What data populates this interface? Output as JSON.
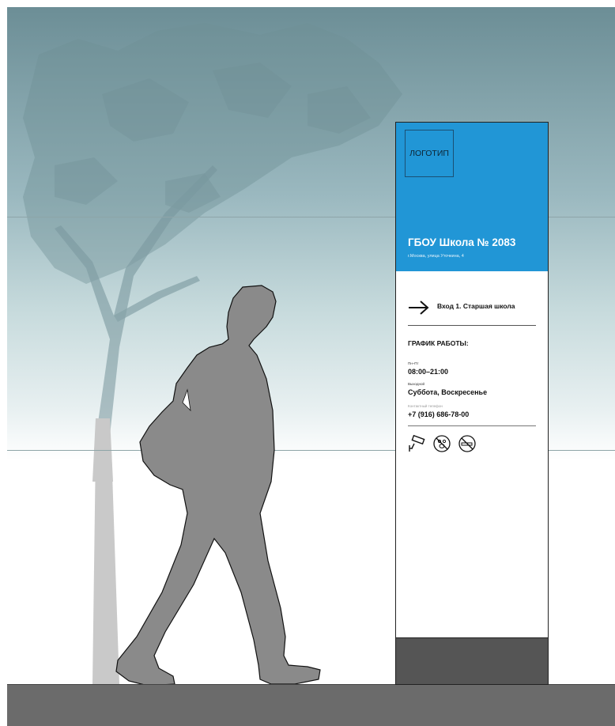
{
  "logo": {
    "label": "ЛОГОТИП"
  },
  "school": {
    "name": "ГБОУ Школа № 2083",
    "address": "г.Москва, улица Уточкина, 4"
  },
  "entry": {
    "label": "Вход 1. Старшая школа"
  },
  "schedule": {
    "title": "ГРАФИК РАБОТЫ:",
    "weekdays_label": "Пн–Пт",
    "weekdays_hours": "08:00–21:00",
    "weekend_label": "Выходной",
    "weekend_days": "Суббота, Воскресенье",
    "phone_label": "Контактный телефон",
    "phone": "+7 (916) 686-78-00"
  },
  "pictograms": [
    "cctv-camera-icon",
    "no-pets-icon",
    "no-smoking-icon"
  ],
  "colors": {
    "sign_header": "#2196d6",
    "plinth": "#555555",
    "ground": "#6b6b6b",
    "silhouette_person": "#8a8a8a",
    "silhouette_tree": "#6f8f96"
  }
}
